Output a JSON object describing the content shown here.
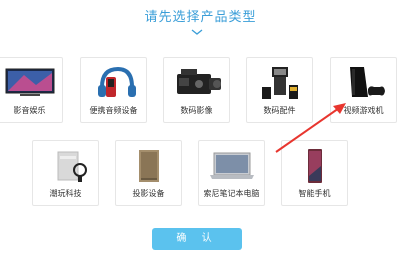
{
  "header": {
    "title": "请先选择产品类型"
  },
  "categories_row1": [
    {
      "label": "影音娱乐",
      "icon": "tv-icon"
    },
    {
      "label": "便携音频设备",
      "icon": "headphones-icon"
    },
    {
      "label": "数码影像",
      "icon": "camcorder-icon"
    },
    {
      "label": "数码配件",
      "icon": "flash-accessory-icon"
    },
    {
      "label": "视频游戏机",
      "icon": "game-console-icon"
    }
  ],
  "categories_row2": [
    {
      "label": "潮玩科技",
      "icon": "gadget-icon"
    },
    {
      "label": "投影设备",
      "icon": "projector-icon"
    },
    {
      "label": "索尼笔记本电脑",
      "icon": "laptop-icon"
    },
    {
      "label": "智能手机",
      "icon": "smartphone-icon"
    }
  ],
  "footer": {
    "confirm_label": "确 认"
  },
  "colors": {
    "accent": "#3a9ed8",
    "button": "#5bc2ee",
    "arrow": "#e8362f",
    "card_border": "#e6e6e6"
  }
}
